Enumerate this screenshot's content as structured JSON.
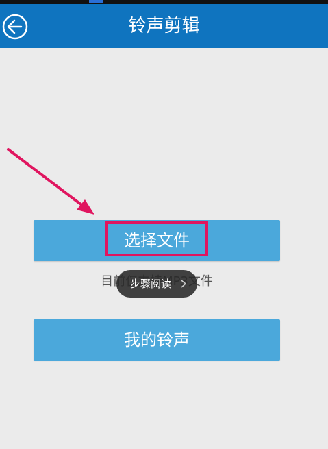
{
  "header": {
    "title": "铃声剪辑",
    "back_icon": "back-arrow-circle-icon"
  },
  "main": {
    "select_file_label": "选择文件",
    "hint_text": "目前仅支持MP3文件",
    "my_ringtone_label": "我的铃声"
  },
  "overlay": {
    "toast_label": "步骤阅读",
    "toast_icon": "chevron-right-icon"
  },
  "annotation": {
    "arrow_color": "#e0155f",
    "highlight_color": "#e0155f"
  },
  "colors": {
    "header_bg": "#0f74bf",
    "button_bg": "#4ba8db",
    "page_bg": "#ebebeb"
  }
}
